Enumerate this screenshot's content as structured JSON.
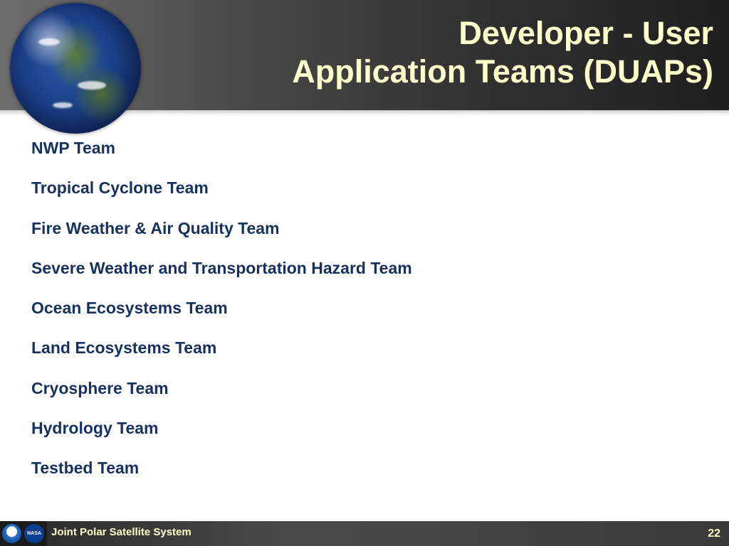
{
  "slide": {
    "title_line1": "Developer - User",
    "title_line2": "Application Teams (DUAPs)",
    "teams": [
      "NWP Team",
      "Tropical Cyclone Team",
      "Fire Weather & Air Quality Team",
      "Severe Weather and Transportation Hazard Team",
      "Ocean Ecosystems Team",
      "Land Ecosystems Team",
      "Cryosphere Team",
      "Hydrology Team",
      "Testbed Team"
    ]
  },
  "footer": {
    "program_name": "Joint Polar Satellite System",
    "page_number": "22",
    "nasa_logo_text": "NASA"
  },
  "colors": {
    "title": "#ffffcc",
    "body_text": "#16315e",
    "header_dark": "#1f1f1f"
  }
}
